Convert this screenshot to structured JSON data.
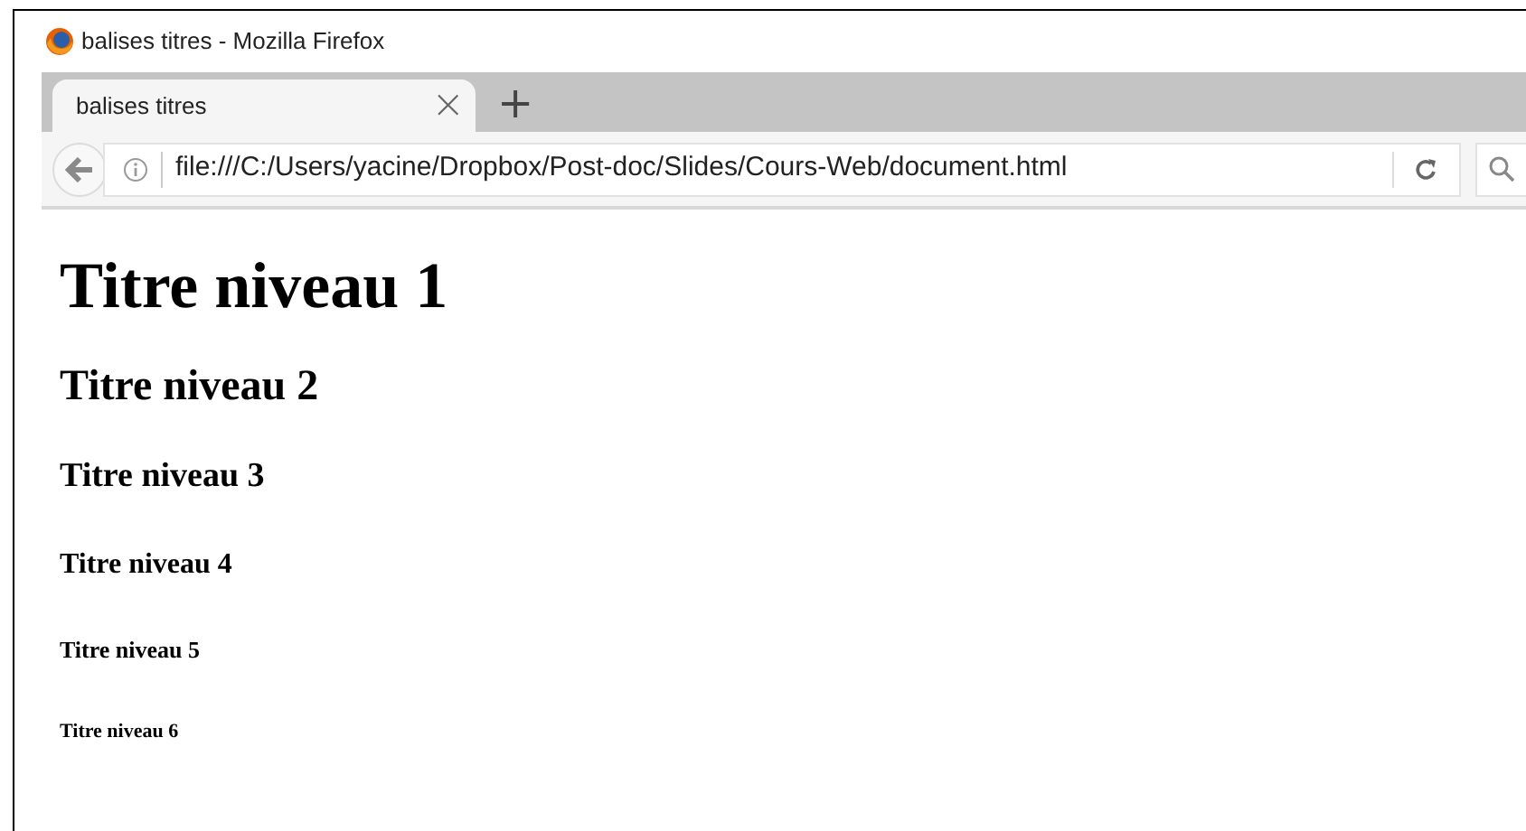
{
  "window": {
    "title": "balises titres - Mozilla Firefox"
  },
  "tabs": [
    {
      "label": "balises titres",
      "selected": true,
      "close": "×"
    }
  ],
  "new_tab": "+",
  "address_bar": {
    "url": "file:///C:/Users/yacine/Dropbox/Post-doc/Slides/Cours-Web/document.html"
  },
  "headings": [
    {
      "kind": "h1",
      "text": "Titre niveau 1"
    },
    {
      "kind": "h2",
      "text": "Titre niveau 2"
    },
    {
      "kind": "h3",
      "text": "Titre niveau 3"
    },
    {
      "kind": "h4",
      "text": "Titre niveau 4"
    },
    {
      "kind": "h5",
      "text": "Titre niveau 5"
    },
    {
      "kind": "h6",
      "text": "Titre niveau 6"
    }
  ]
}
